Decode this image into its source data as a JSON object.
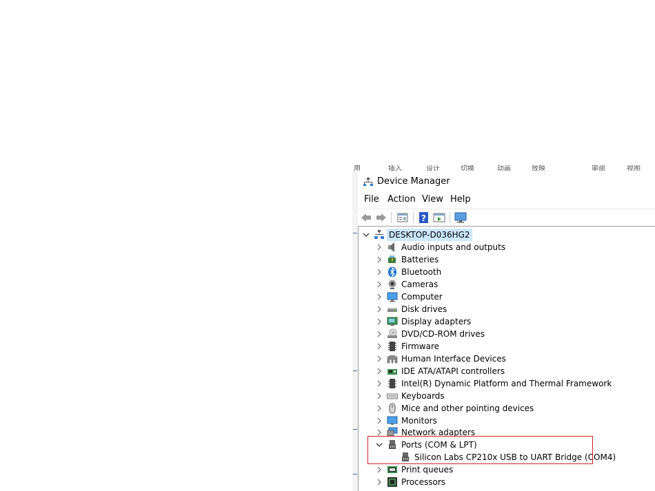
{
  "background_strip": [
    "用",
    "插入",
    "设计",
    "切换",
    "动画",
    "放映",
    "审阅",
    "视图"
  ],
  "window": {
    "title": "Device Manager"
  },
  "menu": [
    "File",
    "Action",
    "View",
    "Help"
  ],
  "toolbar": {
    "buttons": [
      "back-icon",
      "forward-icon",
      "properties-icon",
      "help-icon",
      "update-driver-icon",
      "monitor-icon"
    ]
  },
  "tree": {
    "root": "DESKTOP-D036HG2",
    "categories": [
      {
        "label": "Audio inputs and outputs",
        "icon": "speaker-icon"
      },
      {
        "label": "Batteries",
        "icon": "battery-icon"
      },
      {
        "label": "Bluetooth",
        "icon": "bluetooth-icon"
      },
      {
        "label": "Cameras",
        "icon": "camera-icon"
      },
      {
        "label": "Computer",
        "icon": "computer-icon"
      },
      {
        "label": "Disk drives",
        "icon": "disk-drive-icon"
      },
      {
        "label": "Display adapters",
        "icon": "display-adapter-icon"
      },
      {
        "label": "DVD/CD-ROM drives",
        "icon": "dvd-icon"
      },
      {
        "label": "Firmware",
        "icon": "firmware-icon"
      },
      {
        "label": "Human Interface Devices",
        "icon": "hid-icon"
      },
      {
        "label": "IDE ATA/ATAPI controllers",
        "icon": "ide-controller-icon"
      },
      {
        "label": "Intel(R) Dynamic Platform and Thermal Framework",
        "icon": "chip-icon"
      },
      {
        "label": "Keyboards",
        "icon": "keyboard-icon"
      },
      {
        "label": "Mice and other pointing devices",
        "icon": "mouse-icon"
      },
      {
        "label": "Monitors",
        "icon": "monitor-icon"
      },
      {
        "label": "Network adapters",
        "icon": "network-icon"
      },
      {
        "label": "Ports (COM & LPT)",
        "icon": "port-icon",
        "expanded": true,
        "children": [
          {
            "label": "Silicon Labs CP210x USB to UART Bridge (COM4)",
            "icon": "port-icon"
          }
        ]
      },
      {
        "label": "Print queues",
        "icon": "printer-icon"
      },
      {
        "label": "Processors",
        "icon": "processor-icon"
      }
    ]
  }
}
